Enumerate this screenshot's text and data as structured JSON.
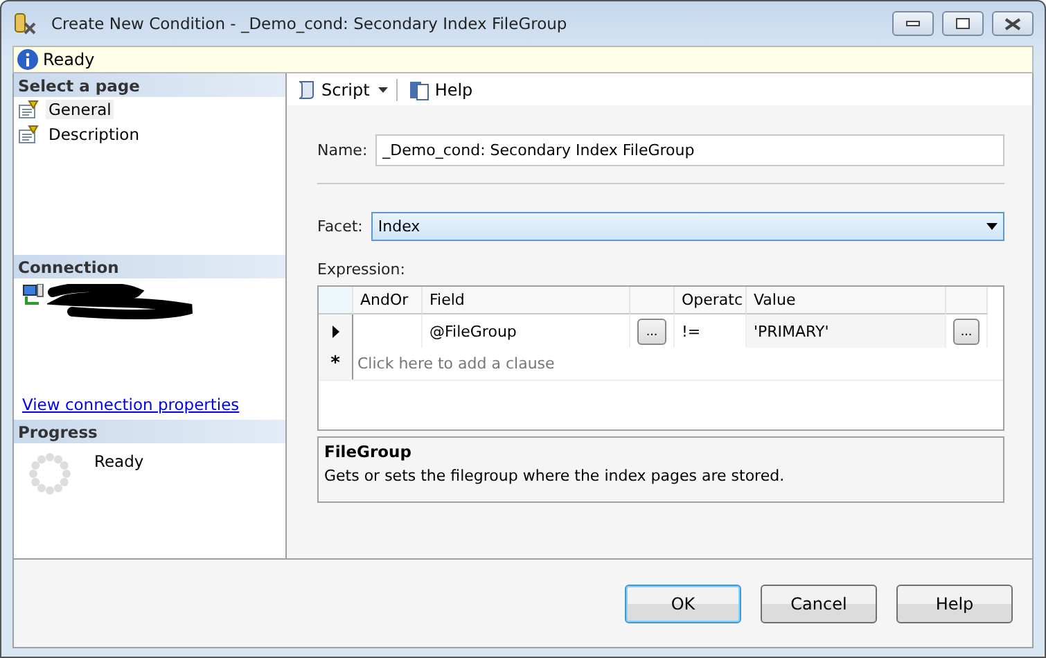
{
  "window": {
    "title": "Create New Condition - _Demo_cond: Secondary Index FileGroup"
  },
  "status": {
    "text": "Ready"
  },
  "sidebar": {
    "header": "Select a page",
    "pages": [
      {
        "label": "General",
        "selected": true
      },
      {
        "label": "Description",
        "selected": false
      }
    ],
    "connection": {
      "header": "Connection",
      "link": "View connection properties"
    },
    "progress": {
      "header": "Progress",
      "text": "Ready"
    }
  },
  "toolbar": {
    "script": "Script",
    "help": "Help"
  },
  "form": {
    "name_label": "Name:",
    "name_value": "_Demo_cond: Secondary Index FileGroup",
    "facet_label": "Facet:",
    "facet_value": "Index",
    "expression_label": "Expression:"
  },
  "grid": {
    "columns": [
      "AndOr",
      "Field",
      "",
      "Operatc",
      "Value",
      ""
    ],
    "rows": [
      {
        "current": true,
        "andor": "",
        "field": "@FileGroup",
        "field_button": "...",
        "operator": "!=",
        "value": "'PRIMARY'",
        "value_button": "..."
      }
    ],
    "new_row_marker": "*",
    "new_row_hint": "Click here to add a clause"
  },
  "description": {
    "title": "FileGroup",
    "text": "Gets or sets the filegroup where the index pages are stored."
  },
  "buttons": [
    {
      "label": "OK",
      "default": true
    },
    {
      "label": "Cancel",
      "default": false
    },
    {
      "label": "Help",
      "default": false
    }
  ]
}
